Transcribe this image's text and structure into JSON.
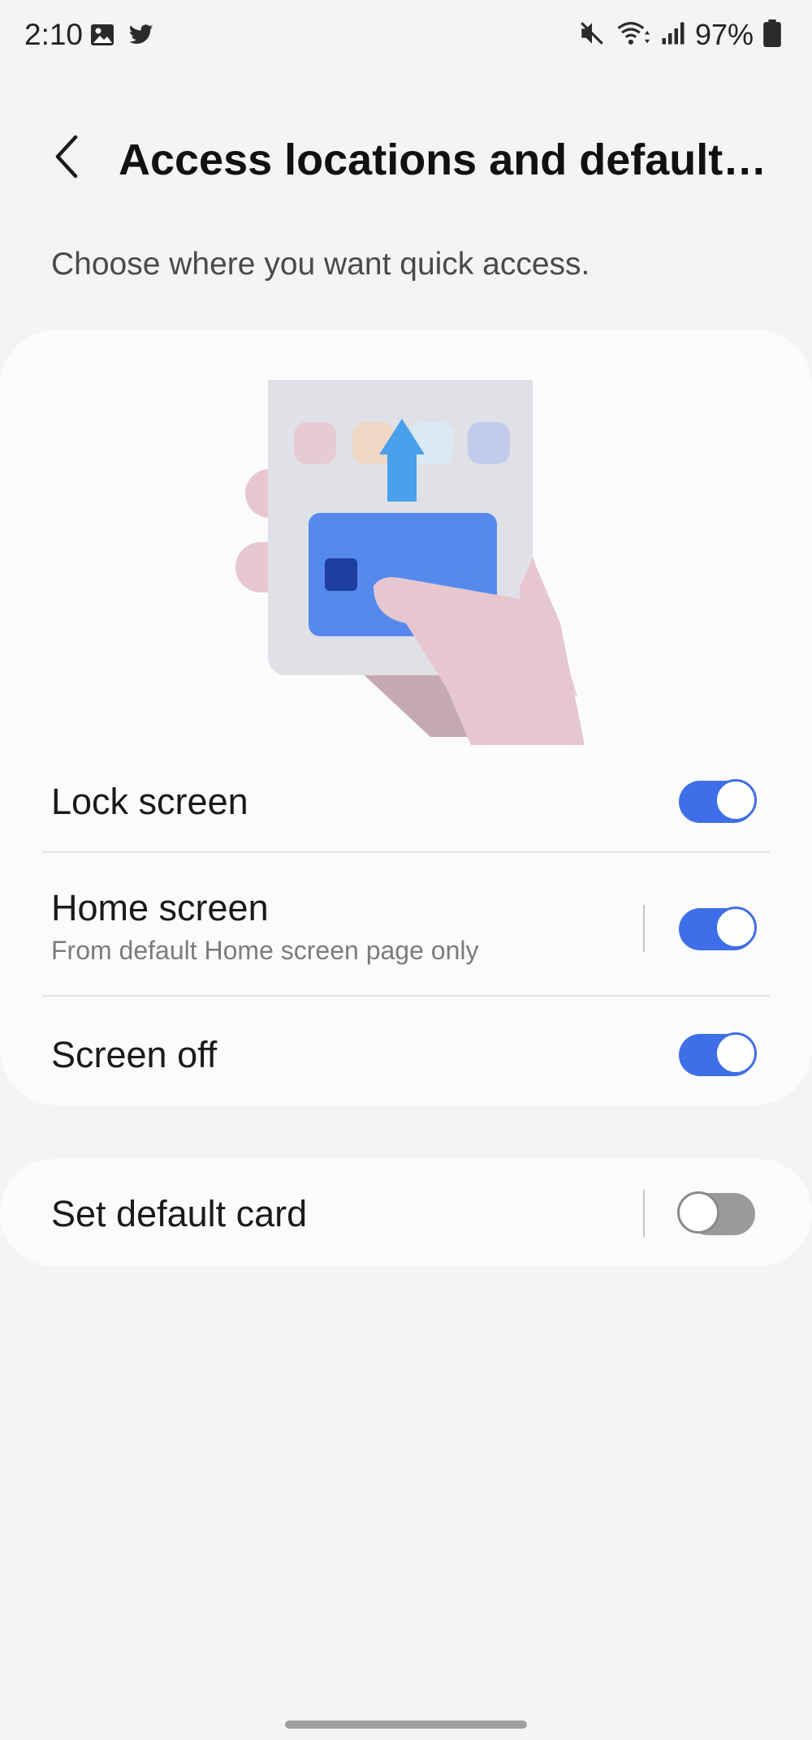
{
  "status_bar": {
    "time": "2:10",
    "battery": "97%",
    "icons": [
      "gallery-icon",
      "twitter-icon",
      "mute-icon",
      "wifi-icon",
      "signal-icon",
      "battery-icon"
    ]
  },
  "header": {
    "back_icon": "chevron-left-icon",
    "title": "Access locations and default c..."
  },
  "subtitle": "Choose where you want quick access.",
  "locations": {
    "lock_screen": {
      "label": "Lock screen",
      "enabled": true
    },
    "home_screen": {
      "label": "Home screen",
      "sublabel": "From default Home screen page only",
      "enabled": true
    },
    "screen_off": {
      "label": "Screen off",
      "enabled": true
    }
  },
  "default_card": {
    "label": "Set default card",
    "enabled": false
  },
  "colors": {
    "accent": "#3e6ee8",
    "switch_off": "#9a9a9a",
    "background": "#f4f4f4",
    "card_background": "#fbfbfb"
  }
}
